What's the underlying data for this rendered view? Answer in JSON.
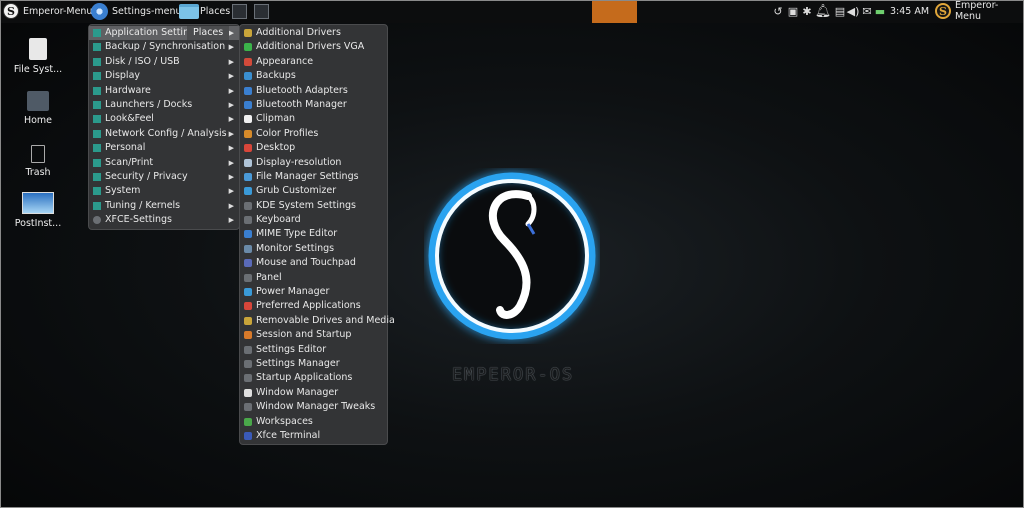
{
  "panel": {
    "emperor_menu": "Emperor-Menu",
    "settings_menu": "Settings-menu",
    "places": "Places",
    "clock": "3:45 AM",
    "right_menu": "Emperor-Menu"
  },
  "desktop": {
    "icons": [
      "File Syst...",
      "Home",
      "Trash",
      "PostInst..."
    ]
  },
  "settings_menu": {
    "places_label": "Places",
    "items": [
      "Application Settings",
      "Backup / Synchronisation",
      "Disk / ISO / USB",
      "Display",
      "Hardware",
      "Launchers / Docks",
      "Look&Feel",
      "Network Config / Analysis",
      "Personal",
      "Scan/Print",
      "Security / Privacy",
      "System",
      "Tuning / Kernels",
      "XFCE-Settings"
    ]
  },
  "app_settings": {
    "items": [
      "Additional Drivers",
      "Additional Drivers VGA",
      "Appearance",
      "Backups",
      "Bluetooth Adapters",
      "Bluetooth Manager",
      "Clipman",
      "Color Profiles",
      "Desktop",
      "Display-resolution",
      "File Manager Settings",
      "Grub Customizer",
      "KDE System Settings",
      "Keyboard",
      "MIME Type Editor",
      "Monitor Settings",
      "Mouse and Touchpad",
      "Panel",
      "Power Manager",
      "Preferred Applications",
      "Removable Drives and Media",
      "Session and Startup",
      "Settings Editor",
      "Settings Manager",
      "Startup Applications",
      "Window Manager",
      "Window Manager Tweaks",
      "Workspaces",
      "Xfce Terminal"
    ],
    "icon_colors": [
      "#c9a53a",
      "#3bb34a",
      "#d24a3a",
      "#3a8fd0",
      "#3a7fd0",
      "#3a7fd0",
      "#f0f0f0",
      "#d68a2a",
      "#d8463a",
      "#b0c4d8",
      "#4a9ad8",
      "#3a9ad8",
      "#6b6f74",
      "#6b6f74",
      "#3a7fd0",
      "#6a8aa8",
      "#5a6ab8",
      "#6b6f74",
      "#3a9ad8",
      "#d8463a",
      "#c9a53a",
      "#d87a2a",
      "#6b6f74",
      "#6b6f74",
      "#6b6f74",
      "#e0e0e0",
      "#6b6f74",
      "#4aa84a",
      "#3a5ab8"
    ]
  },
  "wallpaper": {
    "os_name": "EMPEROR-OS",
    "accent": "#2ba3f0"
  }
}
